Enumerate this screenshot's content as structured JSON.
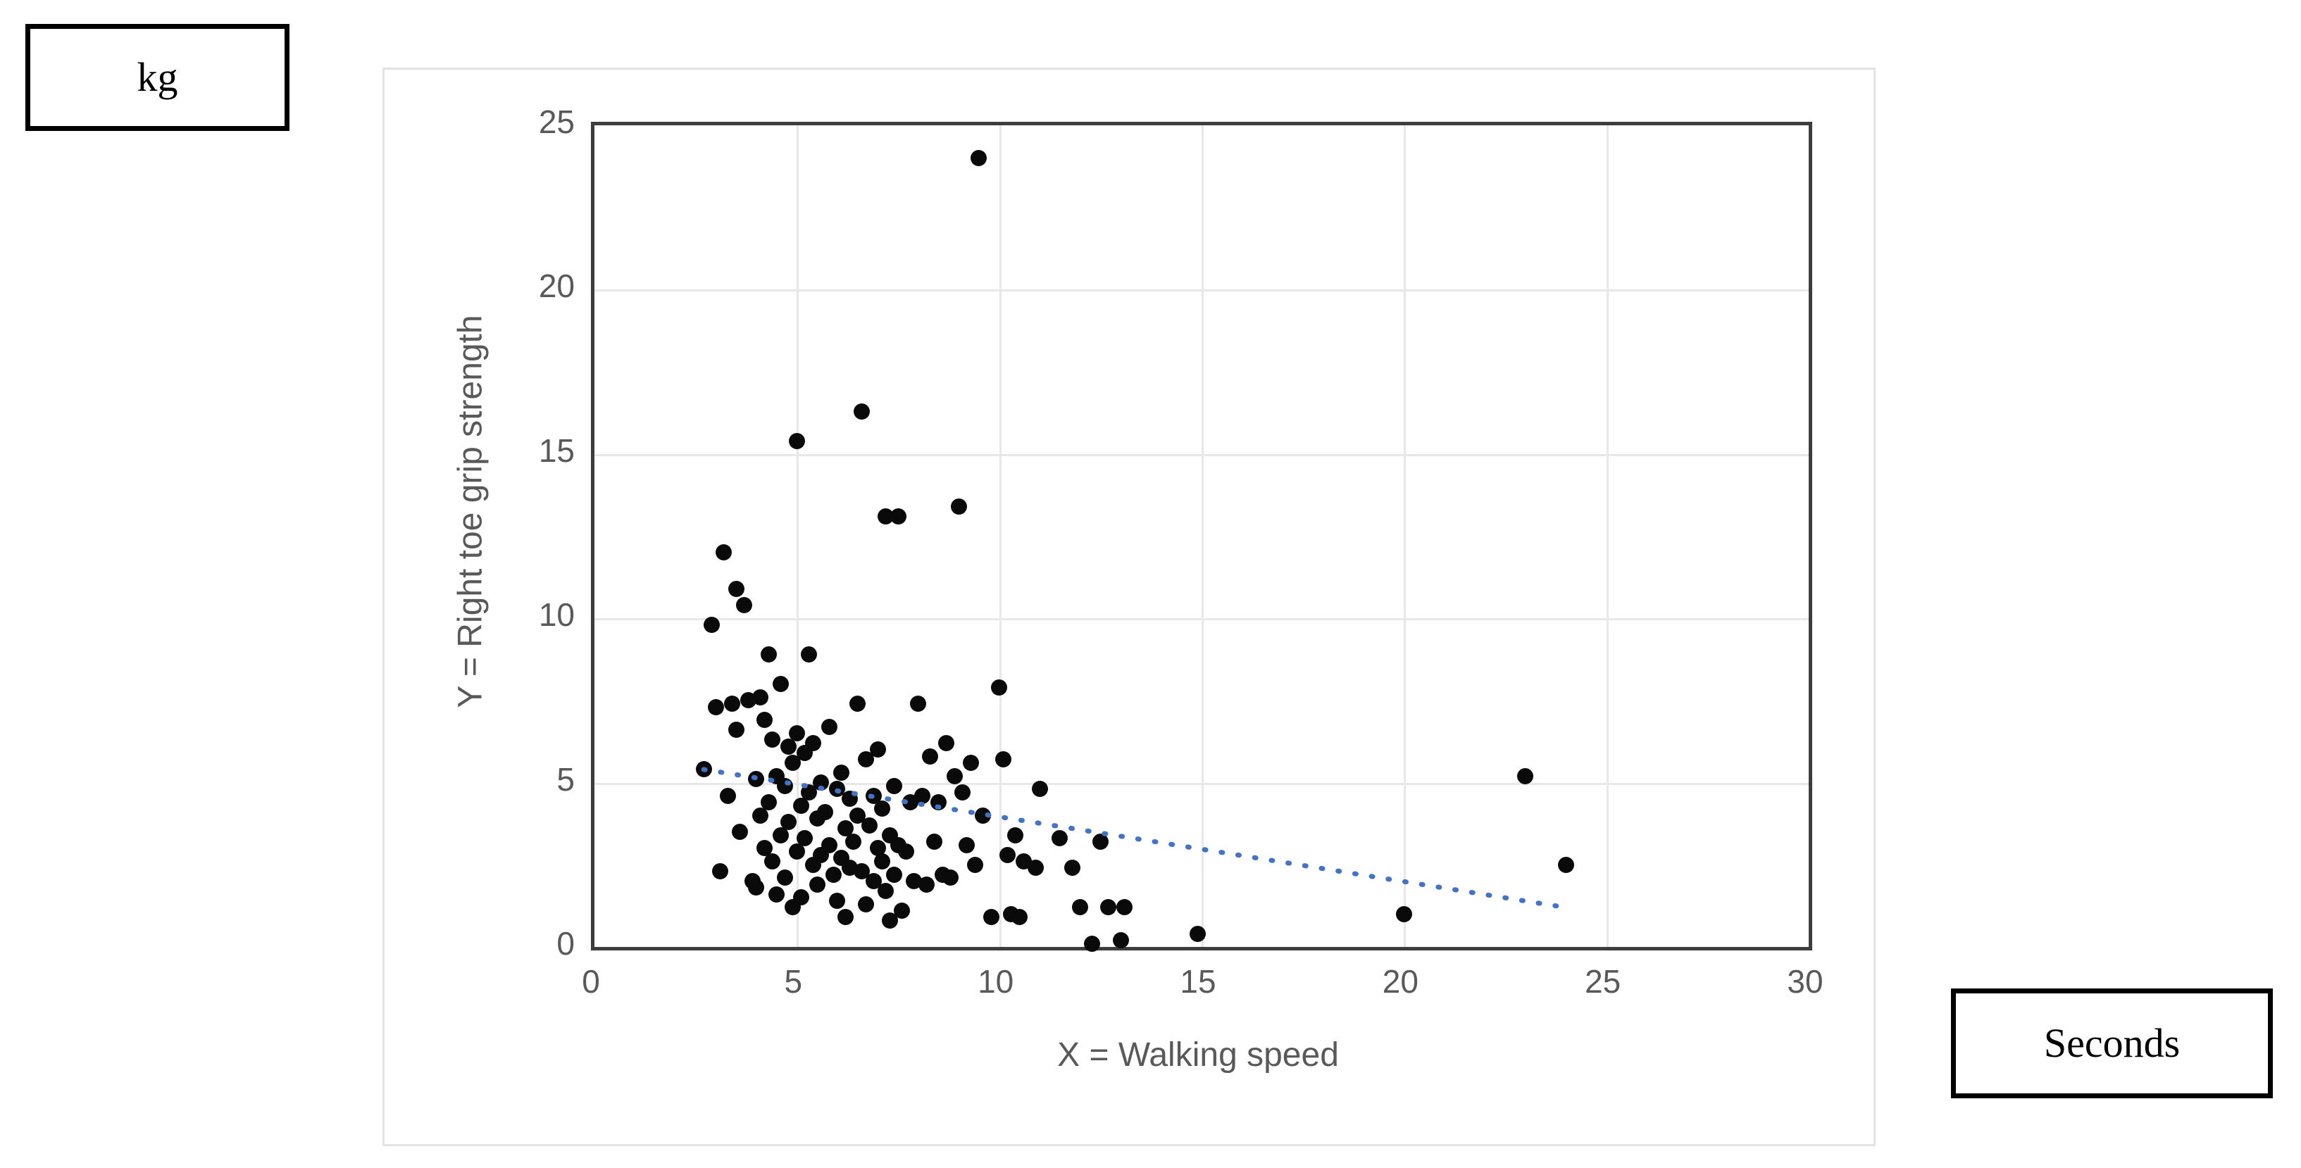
{
  "annotations": {
    "kg_label": "kg",
    "seconds_label": "Seconds"
  },
  "chart_data": {
    "type": "scatter",
    "title": "",
    "xlabel": "X = Walking speed",
    "ylabel": "Y = Right toe grip strength",
    "xlim": [
      0,
      30
    ],
    "ylim": [
      0,
      25
    ],
    "xticks": [
      0,
      5,
      10,
      15,
      20,
      25,
      30
    ],
    "yticks": [
      0,
      5,
      10,
      15,
      20,
      25
    ],
    "grid": true,
    "legend": null,
    "marker_color": "#0a0a0a",
    "marker_shape": "circle",
    "trendline": {
      "style": "dotted",
      "color": "#4472C4",
      "x": [
        2.7,
        24.0
      ],
      "y": [
        5.4,
        1.2
      ]
    },
    "x": [
      2.7,
      2.9,
      3.0,
      3.1,
      3.2,
      3.3,
      3.4,
      3.5,
      3.5,
      3.6,
      3.7,
      3.8,
      3.9,
      4.0,
      4.0,
      4.1,
      4.1,
      4.2,
      4.2,
      4.3,
      4.3,
      4.4,
      4.4,
      4.5,
      4.5,
      4.6,
      4.6,
      4.7,
      4.7,
      4.8,
      4.8,
      4.9,
      4.9,
      5.0,
      5.0,
      5.0,
      5.1,
      5.1,
      5.2,
      5.2,
      5.3,
      5.3,
      5.4,
      5.4,
      5.5,
      5.5,
      5.6,
      5.6,
      5.7,
      5.8,
      5.8,
      5.9,
      6.0,
      6.0,
      6.1,
      6.1,
      6.2,
      6.2,
      6.3,
      6.3,
      6.4,
      6.5,
      6.5,
      6.6,
      6.6,
      6.7,
      6.7,
      6.8,
      6.9,
      6.9,
      7.0,
      7.0,
      7.1,
      7.1,
      7.2,
      7.2,
      7.3,
      7.3,
      7.4,
      7.4,
      7.5,
      7.5,
      7.6,
      7.7,
      7.8,
      7.9,
      8.0,
      8.1,
      8.2,
      8.3,
      8.4,
      8.5,
      8.6,
      8.7,
      8.8,
      8.9,
      9.0,
      9.1,
      9.2,
      9.3,
      9.4,
      9.5,
      9.6,
      9.8,
      10.0,
      10.1,
      10.2,
      10.3,
      10.4,
      10.5,
      10.6,
      10.9,
      11.0,
      11.5,
      11.8,
      12.0,
      12.3,
      12.5,
      12.7,
      13.0,
      13.1,
      14.9,
      20.0,
      23.0,
      24.0
    ],
    "y": [
      5.4,
      9.8,
      7.3,
      2.3,
      12.0,
      4.6,
      7.4,
      10.9,
      6.6,
      3.5,
      10.4,
      7.5,
      2.0,
      5.1,
      1.8,
      7.6,
      4.0,
      6.9,
      3.0,
      8.9,
      4.4,
      2.6,
      6.3,
      5.2,
      1.6,
      8.0,
      3.4,
      4.9,
      2.1,
      6.1,
      3.8,
      5.6,
      1.2,
      15.4,
      6.5,
      2.9,
      4.3,
      1.5,
      5.9,
      3.3,
      8.9,
      4.7,
      2.5,
      6.2,
      3.9,
      1.9,
      5.0,
      2.8,
      4.1,
      6.7,
      3.1,
      2.2,
      4.8,
      1.4,
      5.3,
      2.7,
      3.6,
      0.9,
      4.5,
      2.4,
      3.2,
      7.4,
      4.0,
      16.3,
      2.3,
      5.7,
      1.3,
      3.7,
      4.6,
      2.0,
      6.0,
      3.0,
      2.6,
      4.2,
      13.1,
      1.7,
      3.4,
      0.8,
      4.9,
      2.2,
      13.1,
      3.1,
      1.1,
      2.9,
      4.4,
      2.0,
      7.4,
      4.6,
      1.9,
      5.8,
      3.2,
      4.4,
      2.2,
      6.2,
      2.1,
      5.2,
      13.4,
      4.7,
      3.1,
      5.6,
      2.5,
      24.0,
      4.0,
      0.9,
      7.9,
      5.7,
      2.8,
      1.0,
      3.4,
      0.9,
      2.6,
      2.4,
      4.8,
      3.3,
      2.4,
      1.2,
      0.1,
      3.2,
      1.2,
      0.2,
      1.2,
      0.4,
      1.0,
      5.2,
      2.5
    ]
  }
}
